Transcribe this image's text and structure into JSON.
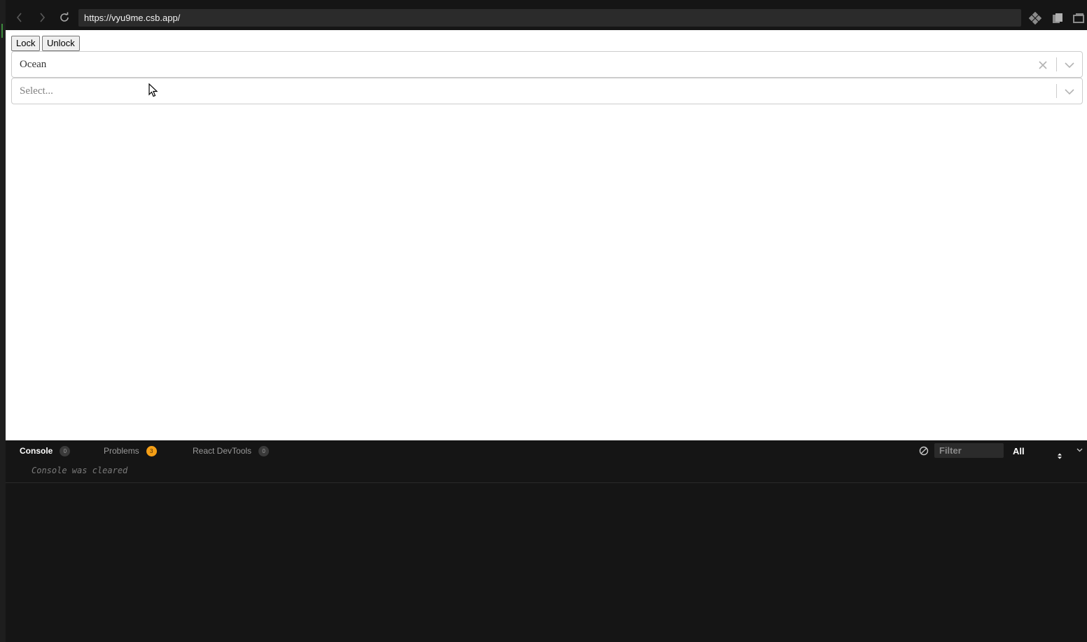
{
  "browser": {
    "url": "https://vyu9me.csb.app/"
  },
  "preview": {
    "lock_label": "Lock",
    "unlock_label": "Unlock",
    "select1": {
      "value": "Ocean"
    },
    "select2": {
      "placeholder": "Select..."
    }
  },
  "devtools": {
    "tabs": [
      {
        "label": "Console",
        "count": "0"
      },
      {
        "label": "Problems",
        "count": "3"
      },
      {
        "label": "React DevTools",
        "count": "0"
      }
    ],
    "filter_placeholder": "Filter",
    "level": "All",
    "console_message": "Console was cleared"
  },
  "colors": {
    "warning_badge": "#f59f16",
    "panel_bg": "#151515",
    "select_border": "#cccccc"
  }
}
